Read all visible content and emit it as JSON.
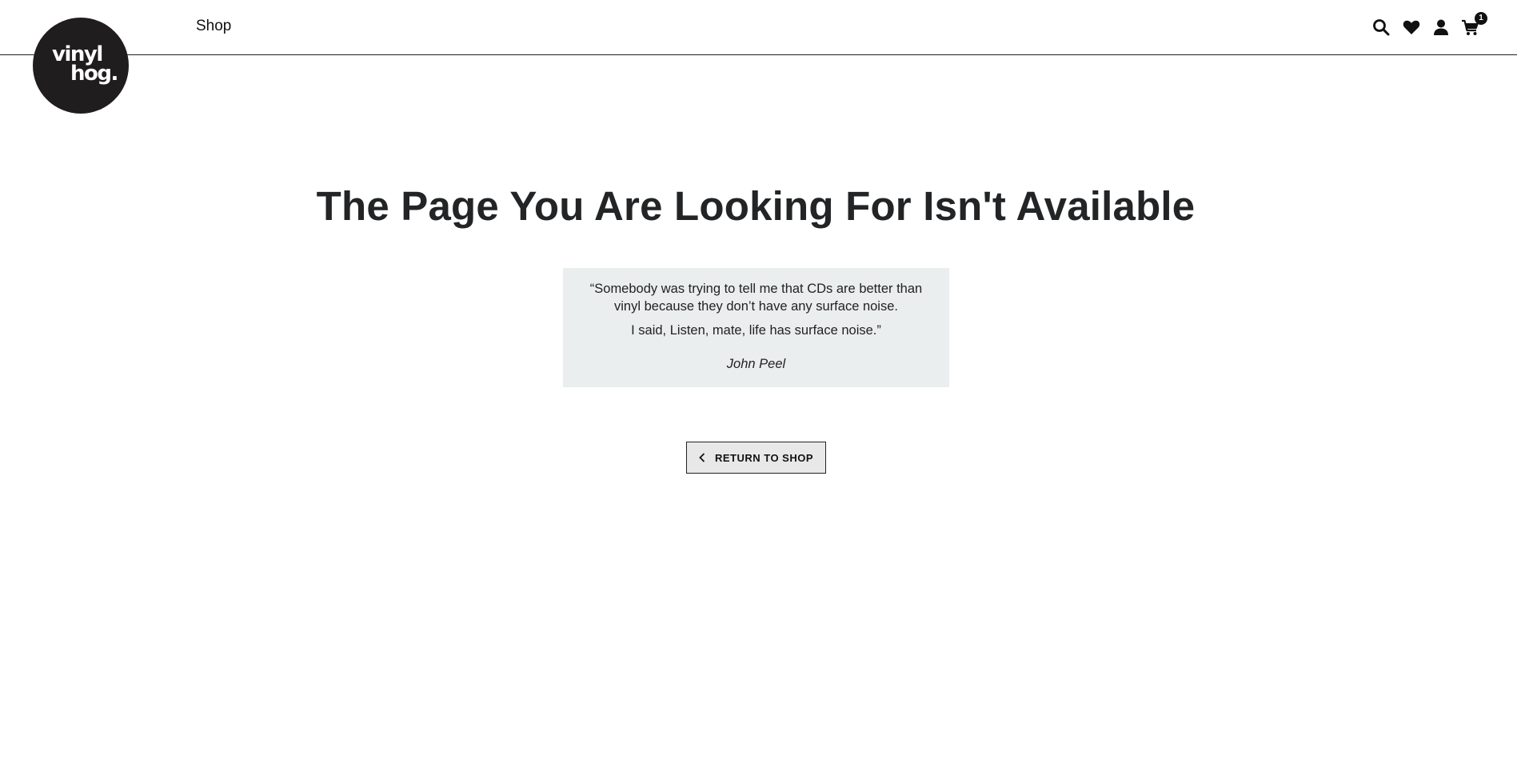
{
  "brand": {
    "logo_line1": "vinyl",
    "logo_line2": "hog."
  },
  "header": {
    "nav_shop_label": "Shop",
    "icons": [
      "search-icon",
      "heart-icon",
      "user-icon",
      "cart-icon"
    ],
    "cart_count": "1"
  },
  "main": {
    "title": "The Page You Are Looking For Isn't Available",
    "quote_line1": "“Somebody was trying to tell me that CDs are better than vinyl because they don’t have any surface noise.",
    "quote_line2": "I said, Listen, mate, life has surface noise.”",
    "quote_author": "John Peel",
    "return_button_label": "RETURN TO SHOP"
  },
  "colors": {
    "logo_bg": "#1f1d1d",
    "quote_bg": "#ebeeee",
    "button_bg": "#e8e8e8",
    "text": "#222426"
  }
}
